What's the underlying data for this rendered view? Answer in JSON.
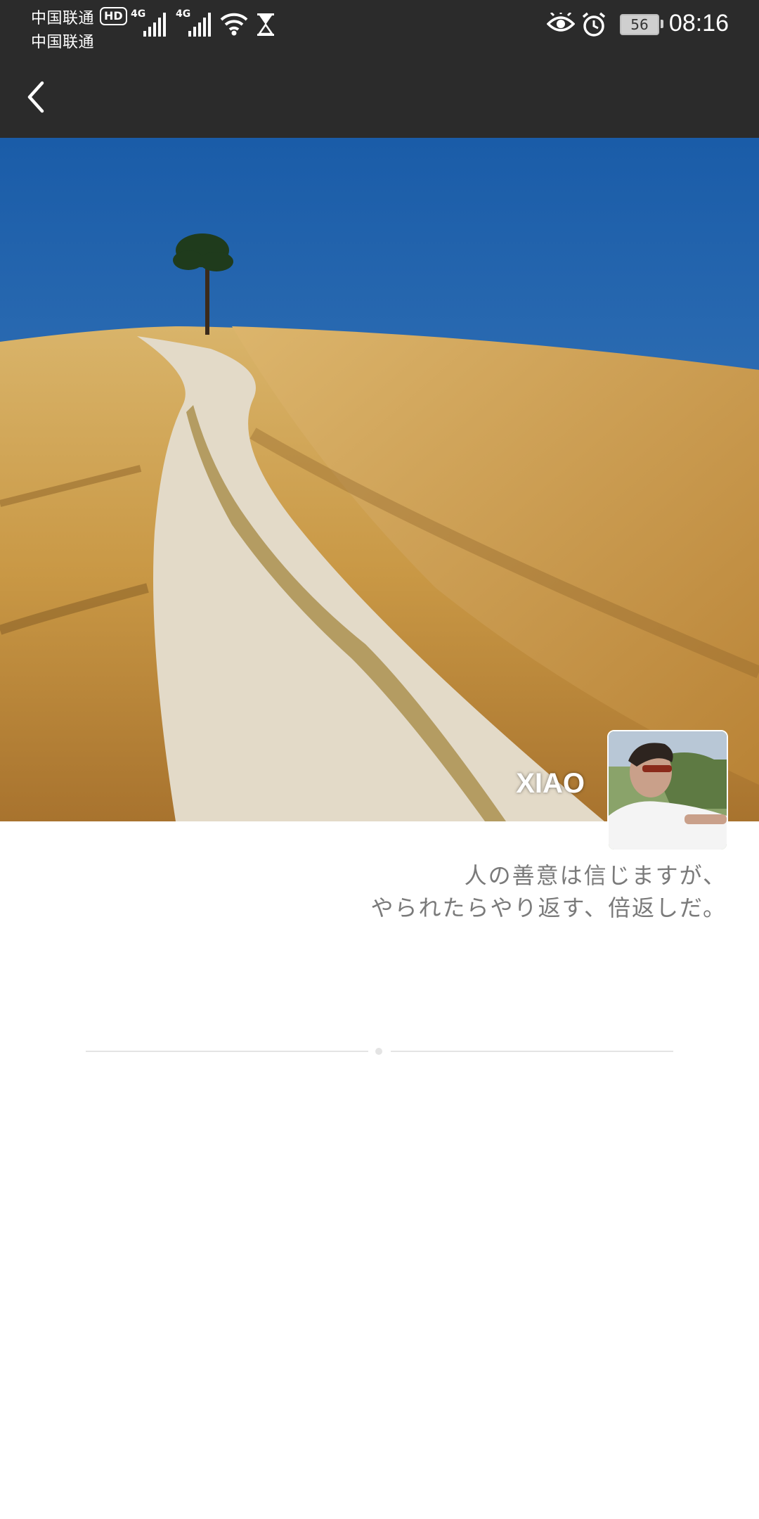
{
  "status_bar": {
    "carrier_1": "中国联通",
    "carrier_2": "中国联通",
    "hd_badge": "HD",
    "network_1": "4G",
    "network_2": "4G",
    "battery_level": "56",
    "time": "08:16",
    "icons": [
      "signal-icon",
      "wifi-icon",
      "hourglass-icon",
      "eye-icon",
      "alarm-icon",
      "battery-icon"
    ]
  },
  "header": {
    "back_icon": "chevron-left-icon"
  },
  "profile": {
    "name": "XIAO",
    "avatar_icon": "avatar",
    "bio_line_1": "人の善意は信じますが、",
    "bio_line_2": "やられたらやり返す、倍返しだ。"
  },
  "colors": {
    "topbar": "#2b2b2b",
    "bio_text": "#7a7a7a",
    "divider": "#e4e4e4"
  }
}
